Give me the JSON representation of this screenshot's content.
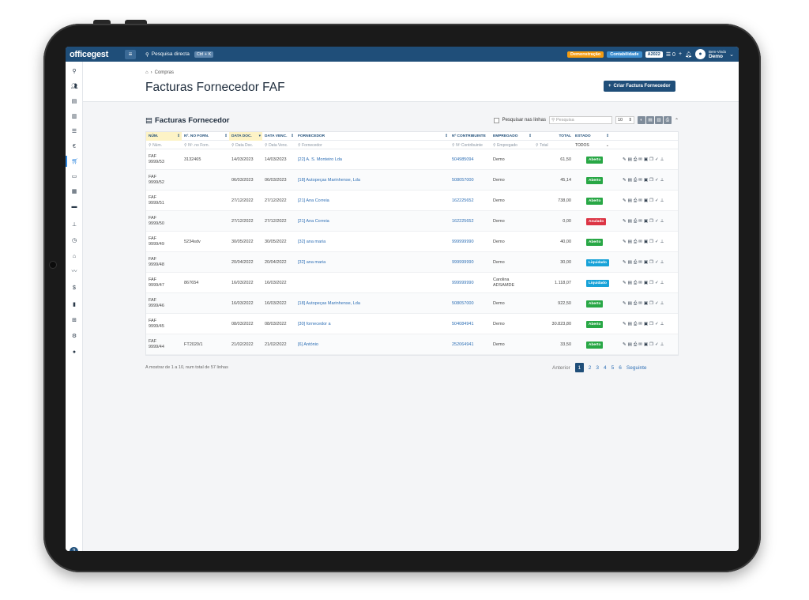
{
  "topbar": {
    "logo": "officegest",
    "search_label": "Pesquisa directa",
    "search_kbd": "Ctrl + K",
    "badge_demo": "Demonstração",
    "badge_cont": "Contabilidade",
    "badge_year": "A2022",
    "counter": "0",
    "welcome_small": "Bem-Vindo",
    "welcome_name": "Demo",
    "colors": {
      "bar": "#1f4e79",
      "demo": "#f39c12",
      "cont": "#3d8fd1"
    }
  },
  "sidebar": {
    "icons": [
      "search-icon",
      "users-icon",
      "book-icon",
      "chart-icon",
      "list-icon",
      "euro-icon",
      "cart-icon",
      "ticket-icon",
      "calculator-icon",
      "box-icon",
      "sitemap-icon",
      "clock-icon",
      "bank-icon",
      "stats-icon",
      "money-icon",
      "file-icon",
      "grid-icon",
      "gears-icon",
      "help-circle-icon"
    ],
    "active": "cart-icon"
  },
  "header": {
    "breadcrumb": "Compras",
    "title": "Facturas Fornecedor FAF",
    "create_button": "Criar Factura Fornecedor"
  },
  "panel": {
    "title": "Facturas Fornecedor",
    "search_in_rows": "Pesquisar nas linhas",
    "search_placeholder": "Pesquisa",
    "page_size": "10"
  },
  "table": {
    "headers": {
      "num": "NÚM.",
      "nforn": "Nº. NO FORN.",
      "datadoc": "DATA DOC.",
      "datavenc": "DATA VENC.",
      "fornecedor": "FORNECEDOR",
      "contrib": "Nº CONTRIBUINTE",
      "empregado": "EMPREGADO",
      "total": "TOTAL",
      "estado": "ESTADO"
    },
    "filters": {
      "num": "Núm.",
      "nforn": "Nº. no Forn.",
      "datadoc": "Data Doc.",
      "datavenc": "Data Venc.",
      "fornecedor": "Fornecedor",
      "contrib": "Nº Contribuinte",
      "empregado": "Empregado",
      "total": "Total",
      "estado": "TODOS"
    },
    "rows": [
      {
        "doc1": "FAF",
        "doc2": "9999/53",
        "nforn": "3132465",
        "datadoc": "14/03/2023",
        "datavenc": "14/03/2023",
        "fornecedor": "[22] A. S. Monteiro Lda",
        "contrib": "504985094",
        "emp1": "Demo",
        "emp2": "",
        "total": "61,50",
        "estado": "Aberto",
        "cor": "#28a745"
      },
      {
        "doc1": "FAF",
        "doc2": "9999/52",
        "nforn": "",
        "datadoc": "06/03/2023",
        "datavenc": "06/03/2023",
        "fornecedor": "[18] Autopeças Marinhense, Lda",
        "contrib": "508057000",
        "emp1": "Demo",
        "emp2": "",
        "total": "45,14",
        "estado": "Aberto",
        "cor": "#28a745"
      },
      {
        "doc1": "FAF",
        "doc2": "9999/51",
        "nforn": "",
        "datadoc": "27/12/2022",
        "datavenc": "27/12/2022",
        "fornecedor": "[21] Ana Correia",
        "contrib": "162225652",
        "emp1": "Demo",
        "emp2": "",
        "total": "738,00",
        "estado": "Aberto",
        "cor": "#28a745"
      },
      {
        "doc1": "FAF",
        "doc2": "9999/50",
        "nforn": "",
        "datadoc": "27/12/2022",
        "datavenc": "27/12/2022",
        "fornecedor": "[21] Ana Correia",
        "contrib": "162225652",
        "emp1": "Demo",
        "emp2": "",
        "total": "0,00",
        "estado": "Anulado",
        "cor": "#dc3545"
      },
      {
        "doc1": "FAF",
        "doc2": "9999/49",
        "nforn": "5234sdv",
        "datadoc": "30/05/2022",
        "datavenc": "30/05/2022",
        "fornecedor": "[32] ana maria",
        "contrib": "999999990",
        "emp1": "Demo",
        "emp2": "",
        "total": "40,00",
        "estado": "Aberto",
        "cor": "#28a745"
      },
      {
        "doc1": "FAF",
        "doc2": "9999/48",
        "nforn": "",
        "datadoc": "20/04/2022",
        "datavenc": "20/04/2022",
        "fornecedor": "[32] ana maria",
        "contrib": "999999990",
        "emp1": "Demo",
        "emp2": "",
        "total": "30,00",
        "estado": "Liquidado",
        "cor": "#17a2d8"
      },
      {
        "doc1": "FAF",
        "doc2": "9999/47",
        "nforn": "867654",
        "datadoc": "16/03/2022",
        "datavenc": "16/03/2022",
        "fornecedor": "",
        "contrib": "999999990",
        "emp1": "Carolina",
        "emp2": "ADSAMDE",
        "total": "1.118,07",
        "estado": "Liquidado",
        "cor": "#17a2d8"
      },
      {
        "doc1": "FAF",
        "doc2": "9999/46",
        "nforn": "",
        "datadoc": "16/03/2022",
        "datavenc": "16/03/2022",
        "fornecedor": "[18] Autopeças Marinhense, Lda",
        "contrib": "508057000",
        "emp1": "Demo",
        "emp2": "",
        "total": "922,50",
        "estado": "Aberto",
        "cor": "#28a745"
      },
      {
        "doc1": "FAF",
        "doc2": "9999/45",
        "nforn": "",
        "datadoc": "08/03/2022",
        "datavenc": "08/03/2022",
        "fornecedor": "[30] fornecedor a",
        "contrib": "504084941",
        "emp1": "Demo",
        "emp2": "",
        "total": "30.823,80",
        "estado": "Aberto",
        "cor": "#28a745"
      },
      {
        "doc1": "FAF",
        "doc2": "9999/44",
        "nforn": "FT2020/1",
        "datadoc": "21/02/2022",
        "datavenc": "21/02/2022",
        "fornecedor": "[6] António",
        "contrib": "252064941",
        "emp1": "Demo",
        "emp2": "",
        "total": "33,50",
        "estado": "Aberto",
        "cor": "#28a745"
      }
    ]
  },
  "footer": {
    "info": "A mostrar de 1 a 10, num total de 57 linhas",
    "prev": "Anterior",
    "pages": [
      "1",
      "2",
      "3",
      "4",
      "5",
      "6"
    ],
    "next": "Seguinte"
  }
}
